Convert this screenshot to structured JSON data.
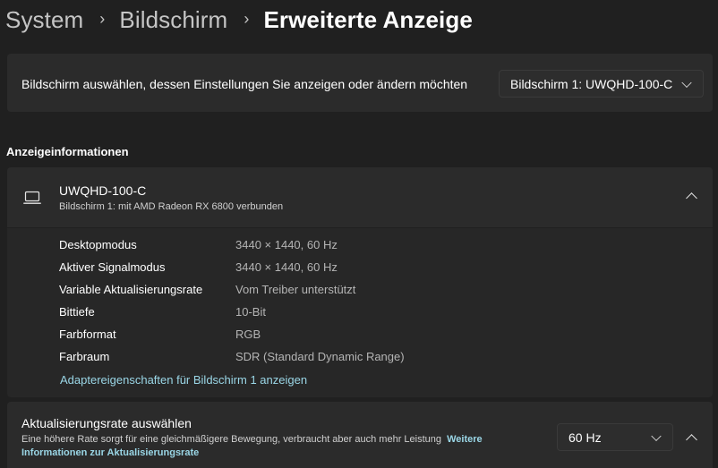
{
  "breadcrumb": {
    "items": [
      "System",
      "Bildschirm"
    ],
    "current": "Erweiterte Anzeige",
    "separator": "›"
  },
  "display_select": {
    "label": "Bildschirm auswählen, dessen Einstellungen Sie anzeigen oder ändern möchten",
    "selected": "Bildschirm 1: UWQHD-100-C"
  },
  "section": {
    "title": "Anzeigeinformationen"
  },
  "display_info": {
    "icon": "laptop-icon",
    "name": "UWQHD-100-C",
    "subtitle": "Bildschirm 1: mit AMD Radeon RX 6800 verbunden",
    "rows": [
      {
        "key": "Desktopmodus",
        "value": "3440 × 1440, 60 Hz"
      },
      {
        "key": "Aktiver Signalmodus",
        "value": "3440 × 1440, 60 Hz"
      },
      {
        "key": "Variable Aktualisierungsrate",
        "value": "Vom Treiber unterstützt"
      },
      {
        "key": "Bittiefe",
        "value": "10-Bit"
      },
      {
        "key": "Farbformat",
        "value": "RGB"
      },
      {
        "key": "Farbraum",
        "value": "SDR (Standard Dynamic Range)"
      }
    ],
    "adapter_link": "Adaptereigenschaften für Bildschirm 1 anzeigen"
  },
  "refresh_rate": {
    "title": "Aktualisierungsrate auswählen",
    "description": "Eine höhere Rate sorgt für eine gleichmäßigere Bewegung, verbraucht aber auch mehr Leistung",
    "link": "Weitere Informationen zur Aktualisierungsrate",
    "selected": "60 Hz"
  },
  "colors": {
    "background": "#202020",
    "card": "#2b2b2b",
    "accent_link": "#9ad6e6",
    "secondary_text": "#b4b4b4"
  }
}
